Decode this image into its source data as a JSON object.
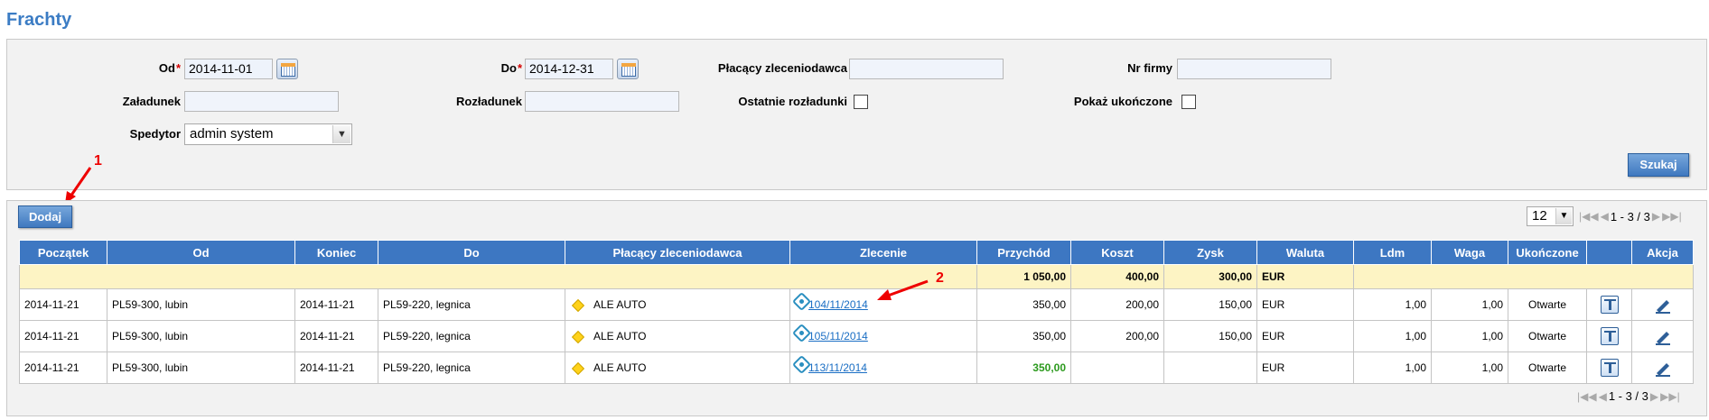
{
  "page_title": "Frachty",
  "filters": {
    "od_label": "Od",
    "od_value": "2014-11-01",
    "do_label": "Do",
    "do_value": "2014-12-31",
    "required_mark": "*",
    "payer_label": "Płacący zleceniodawca",
    "payer_value": "",
    "firm_no_label": "Nr firmy",
    "firm_no_value": "",
    "loading_label": "Załadunek",
    "loading_value": "",
    "unloading_label": "Rozładunek",
    "unloading_value": "",
    "last_unloadings_label": "Ostatnie rozładunki",
    "show_completed_label": "Pokaż ukończone",
    "forwarder_label": "Spedytor",
    "forwarder_value": "admin system",
    "search_button": "Szukaj"
  },
  "results": {
    "add_button": "Dodaj",
    "page_size": "12",
    "pager_text": "1 - 3 / 3",
    "columns": [
      "Początek",
      "Od",
      "Koniec",
      "Do",
      "Płacący zleceniodawca",
      "Zlecenie",
      "Przychód",
      "Koszt",
      "Zysk",
      "Waluta",
      "Ldm",
      "Waga",
      "Ukończone",
      "",
      "Akcja"
    ],
    "summary": {
      "przychod": "1 050,00",
      "koszt": "400,00",
      "zysk": "300,00",
      "waluta": "EUR"
    },
    "rows": [
      {
        "poczatek": "2014-11-21",
        "od": "PL59-300, lubin",
        "koniec": "2014-11-21",
        "do": "PL59-220, legnica",
        "platnik": "ALE AUTO",
        "zlecenie": "104/11/2014",
        "przychod": "350,00",
        "koszt": "200,00",
        "zysk": "150,00",
        "waluta": "EUR",
        "ldm": "1,00",
        "waga": "1,00",
        "ukonczone": "Otwarte"
      },
      {
        "poczatek": "2014-11-21",
        "od": "PL59-300, lubin",
        "koniec": "2014-11-21",
        "do": "PL59-220, legnica",
        "platnik": "ALE AUTO",
        "zlecenie": "105/11/2014",
        "przychod": "350,00",
        "koszt": "200,00",
        "zysk": "150,00",
        "waluta": "EUR",
        "ldm": "1,00",
        "waga": "1,00",
        "ukonczone": "Otwarte"
      },
      {
        "poczatek": "2014-11-21",
        "od": "PL59-300, lubin",
        "koniec": "2014-11-21",
        "do": "PL59-220, legnica",
        "platnik": "ALE AUTO",
        "zlecenie": "113/11/2014",
        "przychod": "350,00",
        "koszt": "",
        "zysk": "",
        "waluta": "EUR",
        "ldm": "1,00",
        "waga": "1,00",
        "ukonczone": "Otwarte"
      }
    ]
  },
  "annotations": {
    "marker_1": "1",
    "marker_2": "2"
  },
  "colors": {
    "title": "#3b7cc4",
    "header": "#3d77c2",
    "summary_row": "#fdf4c4",
    "annotation": "#e00000",
    "income_highlight": "#2c9a1e"
  }
}
